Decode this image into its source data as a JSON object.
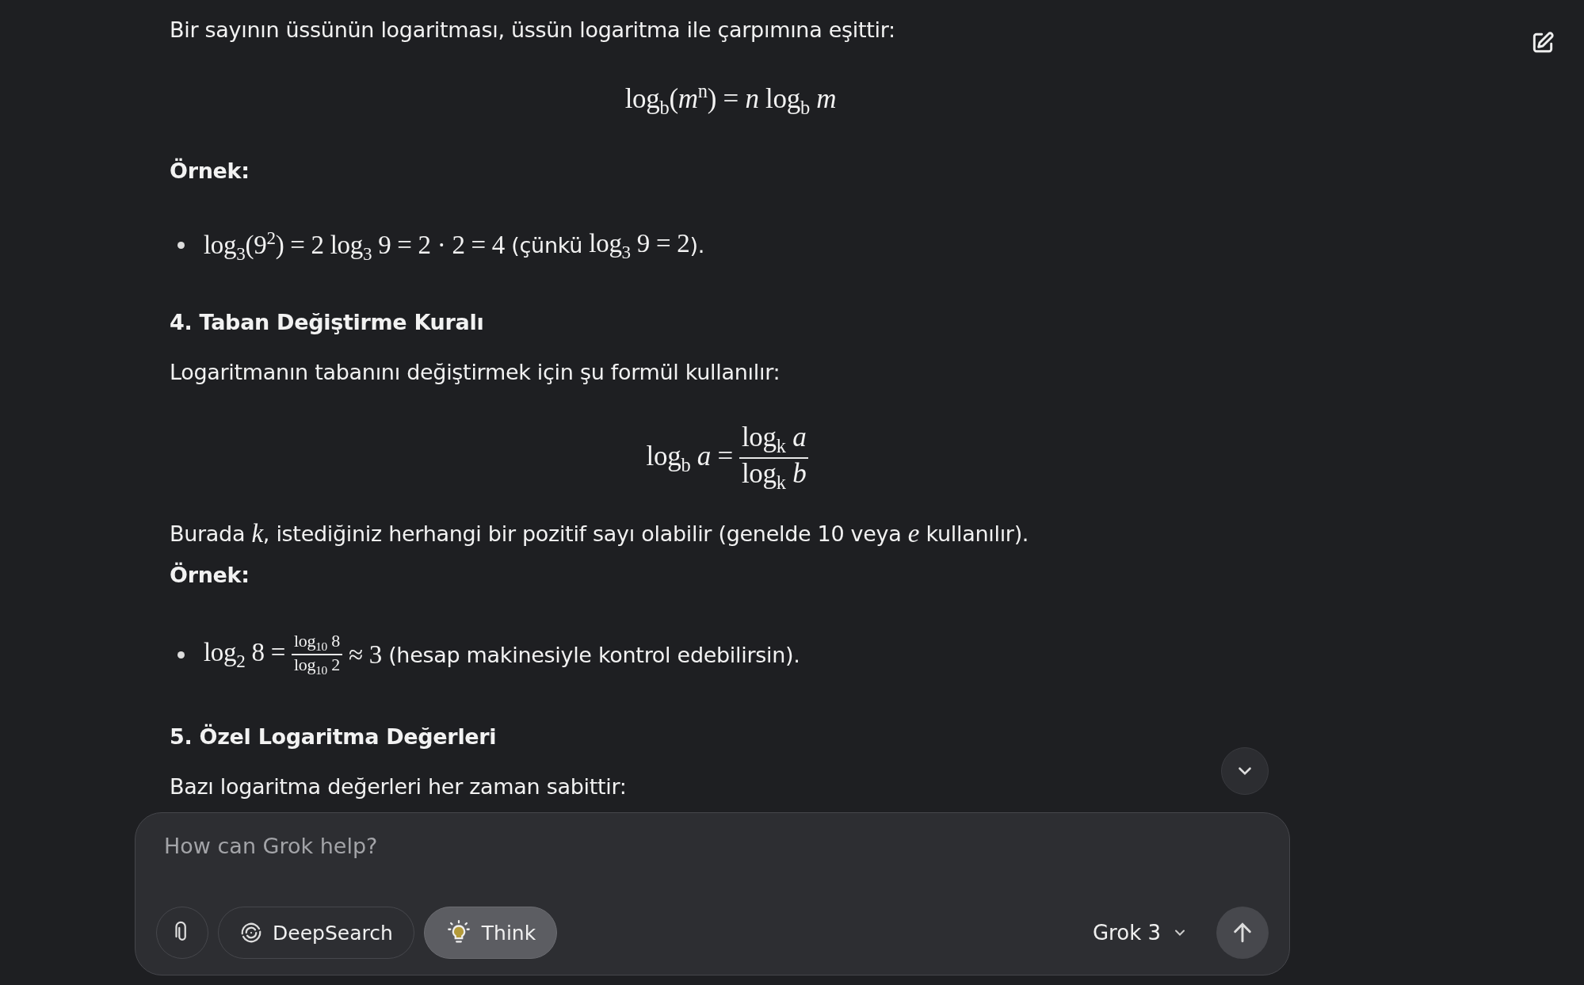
{
  "content": [
    {
      "kind": "paragraph",
      "segments": [
        {
          "kind": "text",
          "text": "Bir sayının üssünün logaritması, üssün logaritma ile çarpımına eşittir:"
        }
      ]
    },
    {
      "kind": "formula",
      "segments": [
        {
          "kind": "math",
          "text": "log$_{b}$(*m*$^{n}$) = *n* log$_{b}$ *m*"
        }
      ]
    },
    {
      "kind": "label",
      "text": "Örnek:"
    },
    {
      "kind": "bullet",
      "segments": [
        {
          "kind": "math",
          "text": "log$_{3}$(9$^{2}$) = 2 log$_{3}$ 9 = 2 · 2 = 4"
        },
        {
          "kind": "text",
          "text": " (çünkü "
        },
        {
          "kind": "math",
          "text": "log$_{3}$ 9 = 2"
        },
        {
          "kind": "text",
          "text": ")."
        }
      ]
    },
    {
      "kind": "heading",
      "text": "4. Taban Değiştirme Kuralı"
    },
    {
      "kind": "paragraph",
      "segments": [
        {
          "kind": "text",
          "text": "Logaritmanın tabanını değiştirmek için şu formül kullanılır:"
        }
      ]
    },
    {
      "kind": "formula",
      "segments": [
        {
          "kind": "math",
          "text": "log$_{b}$ *a* ="
        },
        {
          "kind": "fraction",
          "numerator": "log$_{k}$ *a*",
          "denominator": "log$_{k}$ *b*"
        }
      ]
    },
    {
      "kind": "paragraph",
      "segments": [
        {
          "kind": "text",
          "text": "Burada "
        },
        {
          "kind": "math",
          "text": "*k*"
        },
        {
          "kind": "text",
          "text": ", istediğiniz herhangi bir pozitif sayı olabilir (genelde 10 veya "
        },
        {
          "kind": "math",
          "text": "*e*"
        },
        {
          "kind": "text",
          "text": " kullanılır)."
        }
      ]
    },
    {
      "kind": "label",
      "text": "Örnek:"
    },
    {
      "kind": "bullet",
      "segments": [
        {
          "kind": "math",
          "text": "log$_{2}$ 8 ="
        },
        {
          "kind": "small-fraction",
          "numerator": "log$_{10}$ 8",
          "denominator": "log$_{10}$ 2"
        },
        {
          "kind": "math",
          "text": "≈ 3"
        },
        {
          "kind": "text",
          "text": " (hesap makinesiyle kontrol edebilirsin)."
        }
      ]
    },
    {
      "kind": "heading",
      "text": "5. Özel Logaritma Değerleri"
    },
    {
      "kind": "paragraph",
      "segments": [
        {
          "kind": "text",
          "text": "Bazı logaritma değerleri her zaman sabittir:"
        }
      ]
    }
  ],
  "composer": {
    "placeholder": "How can Grok help?",
    "tools": [
      {
        "kind": "attach"
      },
      {
        "kind": "deepsearch",
        "label": "DeepSearch",
        "selected": false
      },
      {
        "kind": "think",
        "label": "Think",
        "selected": true
      }
    ],
    "model": "Grok 3"
  }
}
